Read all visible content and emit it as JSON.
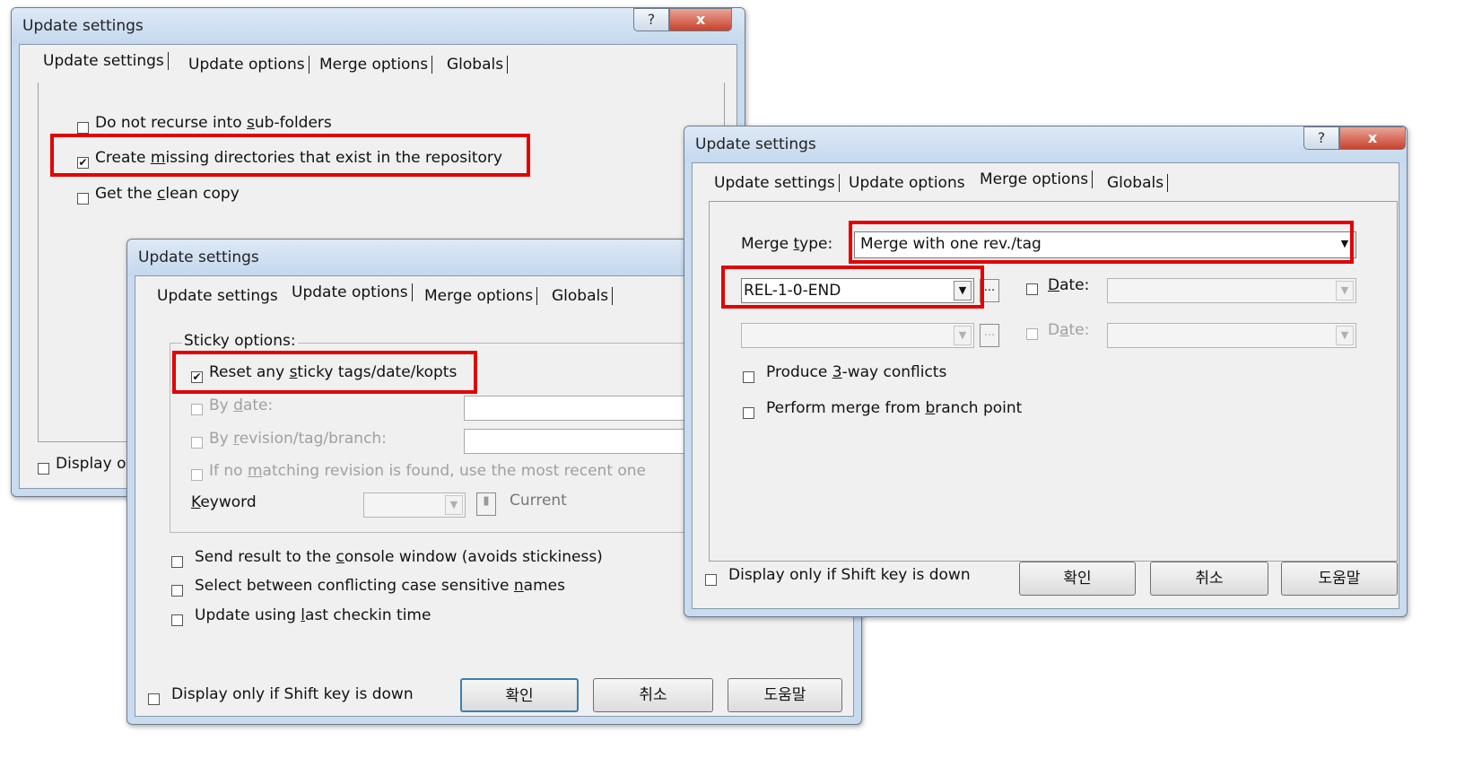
{
  "dlg1": {
    "title": "Update settings",
    "help": "?",
    "close": "x",
    "tabs": [
      "Update settings",
      "Update options",
      "Merge options",
      "Globals"
    ],
    "opts": {
      "o1a": "Do not recurse into ",
      "o1u": "s",
      "o1b": "ub-folders",
      "o2a": "Create ",
      "o2u": "m",
      "o2b": "issing directories that exist in the repository",
      "o3a": "Get the ",
      "o3u": "c",
      "o3b": "lean copy"
    },
    "display": "Display o"
  },
  "dlg2": {
    "title": "Update settings",
    "tabs": [
      "Update settings",
      "Update options",
      "Merge options",
      "Globals"
    ],
    "sticky_group": "Sticky options:",
    "r1a": "Reset any ",
    "r1u": "s",
    "r1b": "ticky tags/date/kopts",
    "r2a": "By ",
    "r2u": "d",
    "r2b": "ate:",
    "r3a": "By ",
    "r3u": "r",
    "r3b": "evision/tag/branch:",
    "r4a": "If no ",
    "r4u": "m",
    "r4b": "atching revision is found, use the most recent one",
    "kw_u": "K",
    "kw_b": "eyword",
    "current": "Current",
    "s1a": "Send result to the ",
    "s1u": "c",
    "s1b": "onsole window (avoids stickiness)",
    "s2a": "Select between conflicting case sensitive ",
    "s2u": "n",
    "s2b": "ames",
    "s3a": "Update using ",
    "s3u": "l",
    "s3b": "ast checkin time",
    "display": "Display only if Shift key is down",
    "ok": "확인",
    "cancel": "취소",
    "helpbtn": "도움말"
  },
  "dlg3": {
    "title": "Update settings",
    "help": "?",
    "close": "x",
    "tabs": [
      "Update settings",
      "Update options",
      "Merge options",
      "Globals"
    ],
    "mt_a": "Merge ",
    "mt_u": "t",
    "mt_b": "ype:",
    "merge_type": "Merge with one rev./tag",
    "rev1": "REL-1-0-END",
    "ellipsis": "...",
    "date1_u": "D",
    "date1_b": "ate:",
    "date2_a": "D",
    "date2_u": "a",
    "date2_b": "te:",
    "p1a": "Produce ",
    "p1u": "3",
    "p1b": "-way conflicts",
    "p2a": "Perform merge from ",
    "p2u": "b",
    "p2b": "ranch point",
    "display": "Display only if Shift key is down",
    "ok": "확인",
    "cancel": "취소",
    "helpbtn": "도움말"
  },
  "icons": {
    "check": "✔",
    "dropdown": "▼",
    "spin": "▮"
  },
  "colors": {
    "highlight": "#e30000",
    "title_bg": "#c9dbef",
    "close": "#c8412c"
  }
}
